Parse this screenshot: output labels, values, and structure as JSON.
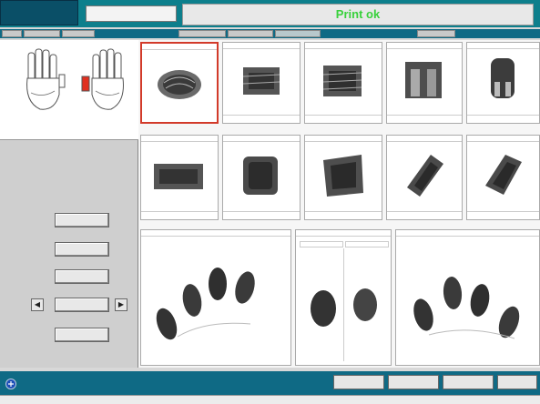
{
  "app": {
    "header_tab": "",
    "header_tab_line2": "",
    "header_tab2": "",
    "title": "Print ok"
  },
  "tabs": [
    {
      "label": ""
    },
    {
      "label": ""
    },
    {
      "label": ""
    },
    {
      "label": ""
    },
    {
      "label": ""
    },
    {
      "label": ""
    },
    {
      "label": ""
    }
  ],
  "left_panel": {
    "left_hand_label": "",
    "right_hand_label": "",
    "buttons": [
      {
        "label": ""
      },
      {
        "label": ""
      },
      {
        "label": ""
      },
      {
        "label": ""
      },
      {
        "label": ""
      }
    ],
    "prev_icon": "◀",
    "next_icon": "▶"
  },
  "fingers_row1": [
    {
      "title": ""
    },
    {
      "title": ""
    },
    {
      "title": ""
    },
    {
      "title": ""
    },
    {
      "title": ""
    }
  ],
  "fingers_row2": [
    {
      "title": ""
    },
    {
      "title": ""
    },
    {
      "title": ""
    },
    {
      "title": ""
    },
    {
      "title": ""
    }
  ],
  "slaps": {
    "left_four": "",
    "thumbs": "",
    "thumbs_left": "",
    "thumbs_right": "",
    "right_four": ""
  },
  "bottom_bar": {
    "brand": "",
    "buttons": [
      {
        "label": ""
      },
      {
        "label": ""
      },
      {
        "label": ""
      },
      {
        "label": ""
      }
    ]
  },
  "statusbar": {
    "text": ""
  },
  "colors": {
    "accent": "#0f6a85",
    "selected": "#d23a2a",
    "title": "#39d13c"
  }
}
